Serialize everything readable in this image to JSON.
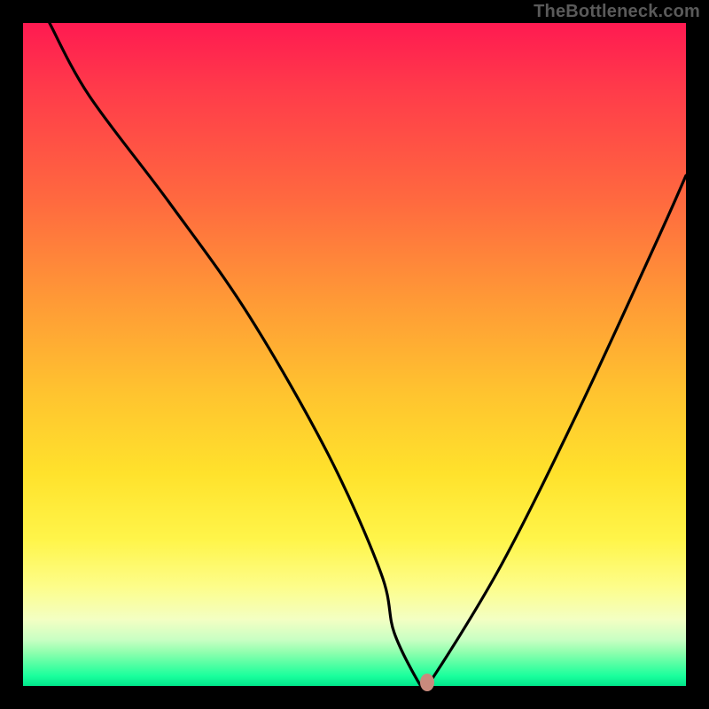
{
  "watermark": "TheBottleneck.com",
  "colors": {
    "frame": "#000000",
    "curve": "#000000",
    "marker": "#c98a7d",
    "watermark": "#5a5a5a"
  },
  "chart_data": {
    "type": "line",
    "title": "",
    "xlabel": "",
    "ylabel": "",
    "xlim": [
      0,
      100
    ],
    "ylim": [
      0,
      100
    ],
    "series": [
      {
        "name": "bottleneck-curve",
        "x": [
          4,
          10,
          22,
          34,
          46,
          54,
          56,
          60,
          61,
          72,
          84,
          96,
          100
        ],
        "values": [
          100,
          89,
          73,
          56,
          35,
          17,
          8,
          0,
          0,
          18,
          42,
          68,
          77
        ]
      }
    ],
    "marker": {
      "x": 61,
      "y": 0
    },
    "gradient_stops": [
      {
        "pct": 0,
        "color": "#ff1a51"
      },
      {
        "pct": 27,
        "color": "#ff6a3f"
      },
      {
        "pct": 56,
        "color": "#ffc42f"
      },
      {
        "pct": 78,
        "color": "#fff54a"
      },
      {
        "pct": 93,
        "color": "#c9ffc3"
      },
      {
        "pct": 100,
        "color": "#00e58a"
      }
    ]
  }
}
